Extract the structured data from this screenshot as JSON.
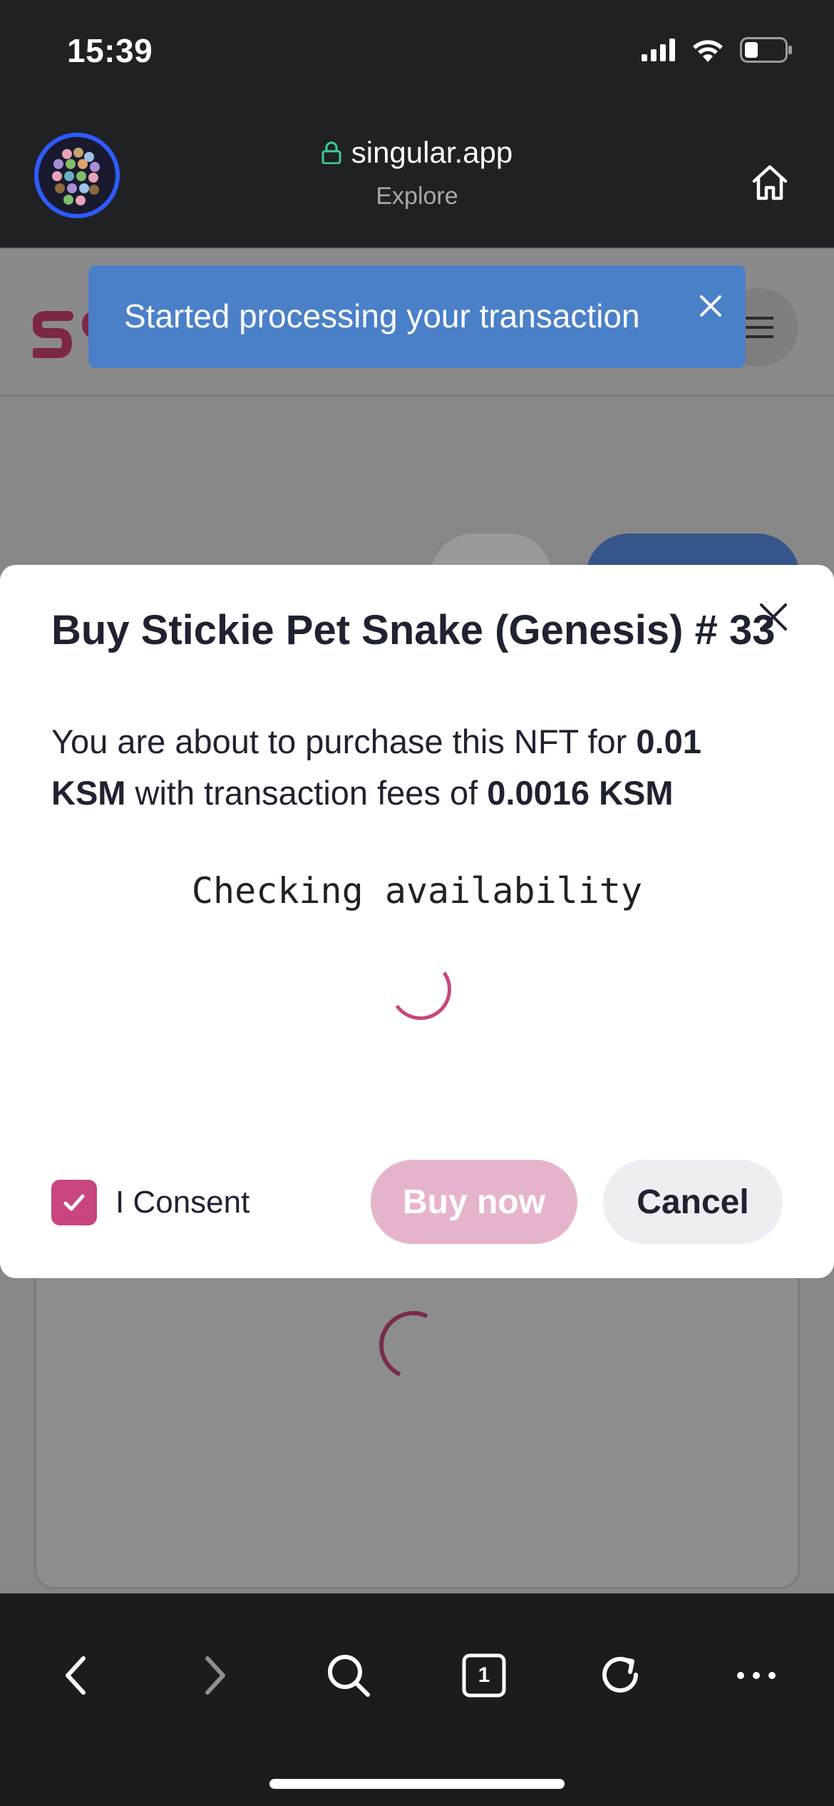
{
  "status_bar": {
    "time": "15:39",
    "icons": [
      "signal-icon",
      "wifi-icon",
      "battery-icon"
    ]
  },
  "browser": {
    "url": "singular.app",
    "subtitle": "Explore",
    "icons": [
      "site-avatar",
      "lock-icon",
      "home-icon"
    ]
  },
  "toast": {
    "message": "Started processing your transaction",
    "color": "#4a80c8"
  },
  "modal": {
    "title": "Buy Stickie Pet Snake (Genesis) # 33",
    "body_prefix": "You are about to purchase this NFT for ",
    "price": "0.01 KSM",
    "body_middle": " with transaction fees of ",
    "fees": "0.0016 KSM",
    "status_text": "Checking availability",
    "consent_label": "I Consent",
    "consent_checked": true,
    "buy_label": "Buy now",
    "cancel_label": "Cancel",
    "accent_color": "#c8457f"
  },
  "toolbar": {
    "tab_count": "1",
    "icons": [
      "back-icon",
      "forward-icon",
      "search-icon",
      "tabs-icon",
      "reload-icon",
      "more-icon"
    ]
  }
}
